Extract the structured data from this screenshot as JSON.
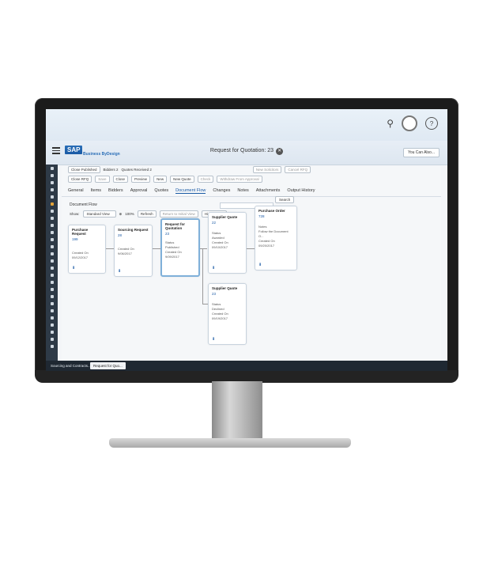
{
  "window": {
    "title": "Request for Quotation: 23",
    "you_can_also": "You Can Also..."
  },
  "brand": {
    "sap": "SAP",
    "product": "Business ByDesign"
  },
  "toolbar": {
    "status_button": "Close Published",
    "bidders_label": "Bidders 2",
    "quotes_received": "Quotes Received 2",
    "save": "Save",
    "close": "Close",
    "preview": "Preview",
    "new": "New",
    "new_quote": "New Quote",
    "check": "Check",
    "withdraw": "Withdraw From Approval",
    "new_solicitors": "New Solicitors",
    "cancel_rfq": "Cancel RFQ",
    "close_rfq": "Close RFQ"
  },
  "tabs": [
    "General",
    "Items",
    "Bidders",
    "Approval",
    "Quotes",
    "Document Flow",
    "Changes",
    "Notes",
    "Attachments",
    "Output History"
  ],
  "active_tab": "Document Flow",
  "document_flow": {
    "title": "Document Flow",
    "show_label": "Show:",
    "view_value": "Standard View",
    "zoom": "100%",
    "refresh": "Refresh",
    "return_initial": "Return to Initial View",
    "hide_details": "Hide Details",
    "search": "Search"
  },
  "cards": [
    {
      "title": "Purchase Request",
      "id": "199",
      "lines": [
        "Created On",
        "09/12/2017"
      ]
    },
    {
      "title": "Sourcing Request",
      "id": "28",
      "lines": [
        "Created On",
        "9/06/2017"
      ]
    },
    {
      "title": "Request for Quotation",
      "id": "23",
      "lines": [
        "Status",
        "Published",
        "Created On",
        "9/09/2017"
      ]
    },
    {
      "title": "Supplier Quote",
      "id": "22",
      "lines": [
        "Status",
        "Awarded",
        "Created On",
        "09/10/2017"
      ]
    },
    {
      "title": "Purchase Order",
      "id": "728",
      "lines": [
        "Notes",
        "Follow the Document O...",
        "Created On",
        "09/20/2017"
      ]
    },
    {
      "title": "Supplier Quote",
      "id": "23",
      "lines": [
        "Status",
        "Declined",
        "Created On",
        "09/19/2017"
      ]
    }
  ],
  "taskbar": {
    "workcenter": "Sourcing and Contracts...",
    "tab": "Request for Quo..."
  },
  "colors": {
    "accent": "#1a5aa5",
    "shell": "#dfe9f3",
    "sidebar": "#2e3a47"
  }
}
